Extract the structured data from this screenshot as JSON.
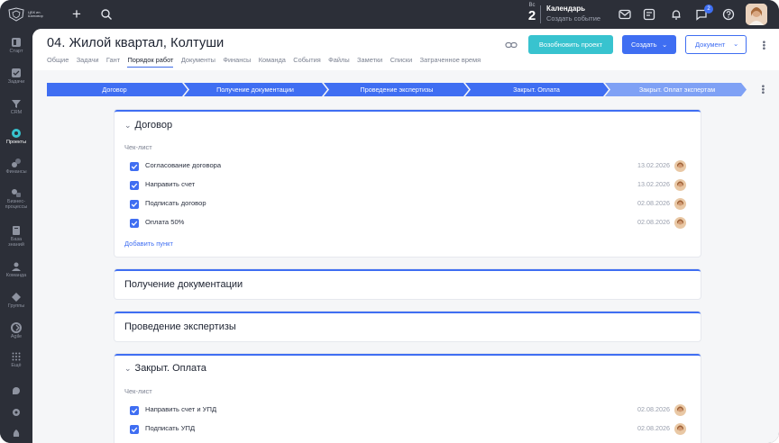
{
  "app": {
    "logo_text": "ЦБК ин. Шиповир",
    "day_of_week": "Вс",
    "day_number": "2",
    "calendar_title": "Календарь",
    "calendar_sub": "Создать событие",
    "notification_count": "2"
  },
  "sidebar": {
    "items": [
      {
        "label": "Старт",
        "icon": "start-icon"
      },
      {
        "label": "Задачи",
        "icon": "tasks-icon"
      },
      {
        "label": "CRM",
        "icon": "crm-icon"
      },
      {
        "label": "Проекты",
        "icon": "projects-icon"
      },
      {
        "label": "Финансы",
        "icon": "finance-icon"
      },
      {
        "label": "Бизнес-\nпроцессы",
        "icon": "business-process-icon"
      },
      {
        "label": "База\nзнаний",
        "icon": "knowledge-icon"
      },
      {
        "label": "Команда",
        "icon": "team-icon"
      },
      {
        "label": "Группы",
        "icon": "groups-icon"
      },
      {
        "label": "Agile",
        "icon": "agile-icon"
      },
      {
        "label": "Ещё",
        "icon": "more-grid-icon"
      },
      {
        "label": "",
        "icon": "help-icon"
      },
      {
        "label": "",
        "icon": "settings-icon"
      },
      {
        "label": "",
        "icon": "rocket-icon"
      }
    ]
  },
  "header": {
    "title": "04. Жилой квартал, Колтуши",
    "tabs": [
      "Общие",
      "Задачи",
      "Гант",
      "Порядок работ",
      "Документы",
      "Финансы",
      "Команда",
      "События",
      "Файлы",
      "Заметки",
      "Списки",
      "Затраченное время"
    ],
    "active_tab": "Порядок работ",
    "reopen_label": "Возобновить проект",
    "create_label": "Создать",
    "document_label": "Документ"
  },
  "stages": [
    {
      "label": "Договор",
      "state": "done"
    },
    {
      "label": "Получение документации",
      "state": "done"
    },
    {
      "label": "Проведение экспертизы",
      "state": "done"
    },
    {
      "label": "Закрыт. Оплата",
      "state": "done"
    },
    {
      "label": "Закрыт. Оплат экспертам",
      "state": "todo"
    }
  ],
  "cards": {
    "c1": {
      "title": "Договор",
      "checklist_label": "Чек-лист",
      "items": [
        {
          "text": "Согласование договора",
          "date": "13.02.2026",
          "checked": true
        },
        {
          "text": "Направить счет",
          "date": "13.02.2026",
          "checked": true
        },
        {
          "text": "Подписать договор",
          "date": "02.08.2026",
          "checked": true
        },
        {
          "text": "Оплата 50%",
          "date": "02.08.2026",
          "checked": true
        }
      ],
      "add_label": "Добавить пункт"
    },
    "c2": {
      "title": "Получение документации"
    },
    "c3": {
      "title": "Проведение экспертизы"
    },
    "c4": {
      "title": "Закрыт. Оплата",
      "checklist_label": "Чек-лист",
      "items": [
        {
          "text": "Направить счет и УПД",
          "date": "02.08.2026",
          "checked": true
        },
        {
          "text": "Подписать УПД",
          "date": "02.08.2026",
          "checked": true
        }
      ]
    }
  },
  "colors": {
    "accent": "#3f6ef2",
    "teal": "#38c3cf",
    "sidebar_bg": "#2c2f38"
  }
}
